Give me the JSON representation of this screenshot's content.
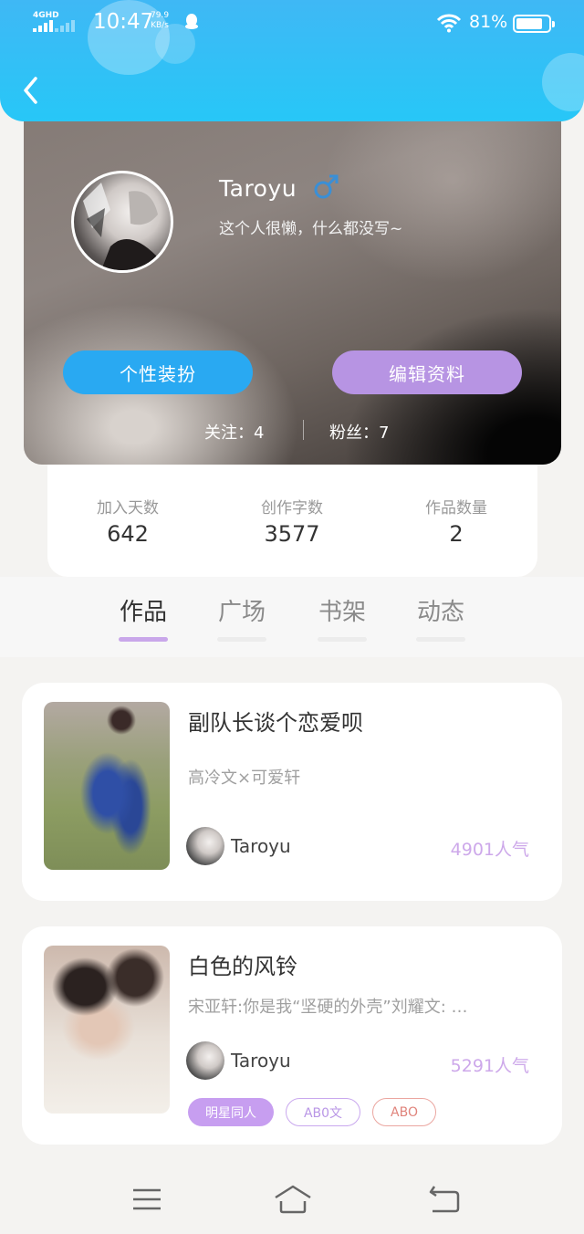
{
  "status_bar": {
    "network": "4GHD",
    "time": "10:47",
    "speed_value": "79.9",
    "speed_unit": "KB/s",
    "battery": "81%",
    "battery_level": 0.81
  },
  "profile": {
    "username": "Taroyu",
    "gender_icon": "male-icon",
    "bio": "这个人很懒，什么都没写~",
    "dress_button": "个性装扮",
    "edit_button": "编辑资料",
    "following_text": "关注：4",
    "fans_text": "粉丝：7"
  },
  "stats": [
    {
      "label": "加入天数",
      "value": "642"
    },
    {
      "label": "创作字数",
      "value": "3577"
    },
    {
      "label": "作品数量",
      "value": "2"
    }
  ],
  "tabs": [
    {
      "label": "作品",
      "active": true
    },
    {
      "label": "广场",
      "active": false
    },
    {
      "label": "书架",
      "active": false
    },
    {
      "label": "动态",
      "active": false
    }
  ],
  "works": [
    {
      "title": "副队长谈个恋爱呗",
      "description": "高冷文×可爱轩",
      "author": "Taroyu",
      "popularity": "4901人气",
      "tags": []
    },
    {
      "title": "白色的风铃",
      "description": "宋亚轩:你是我“坚硬的外壳”刘耀文: …",
      "author": "Taroyu",
      "popularity": "5291人气",
      "tags": [
        "明星同人",
        "AB0文",
        "ABO"
      ]
    }
  ],
  "colors": {
    "header": "#3fb8f5",
    "dress_button": "#29a9f2",
    "edit_button": "#b794e3",
    "accent_purple": "#c9a7ea"
  }
}
